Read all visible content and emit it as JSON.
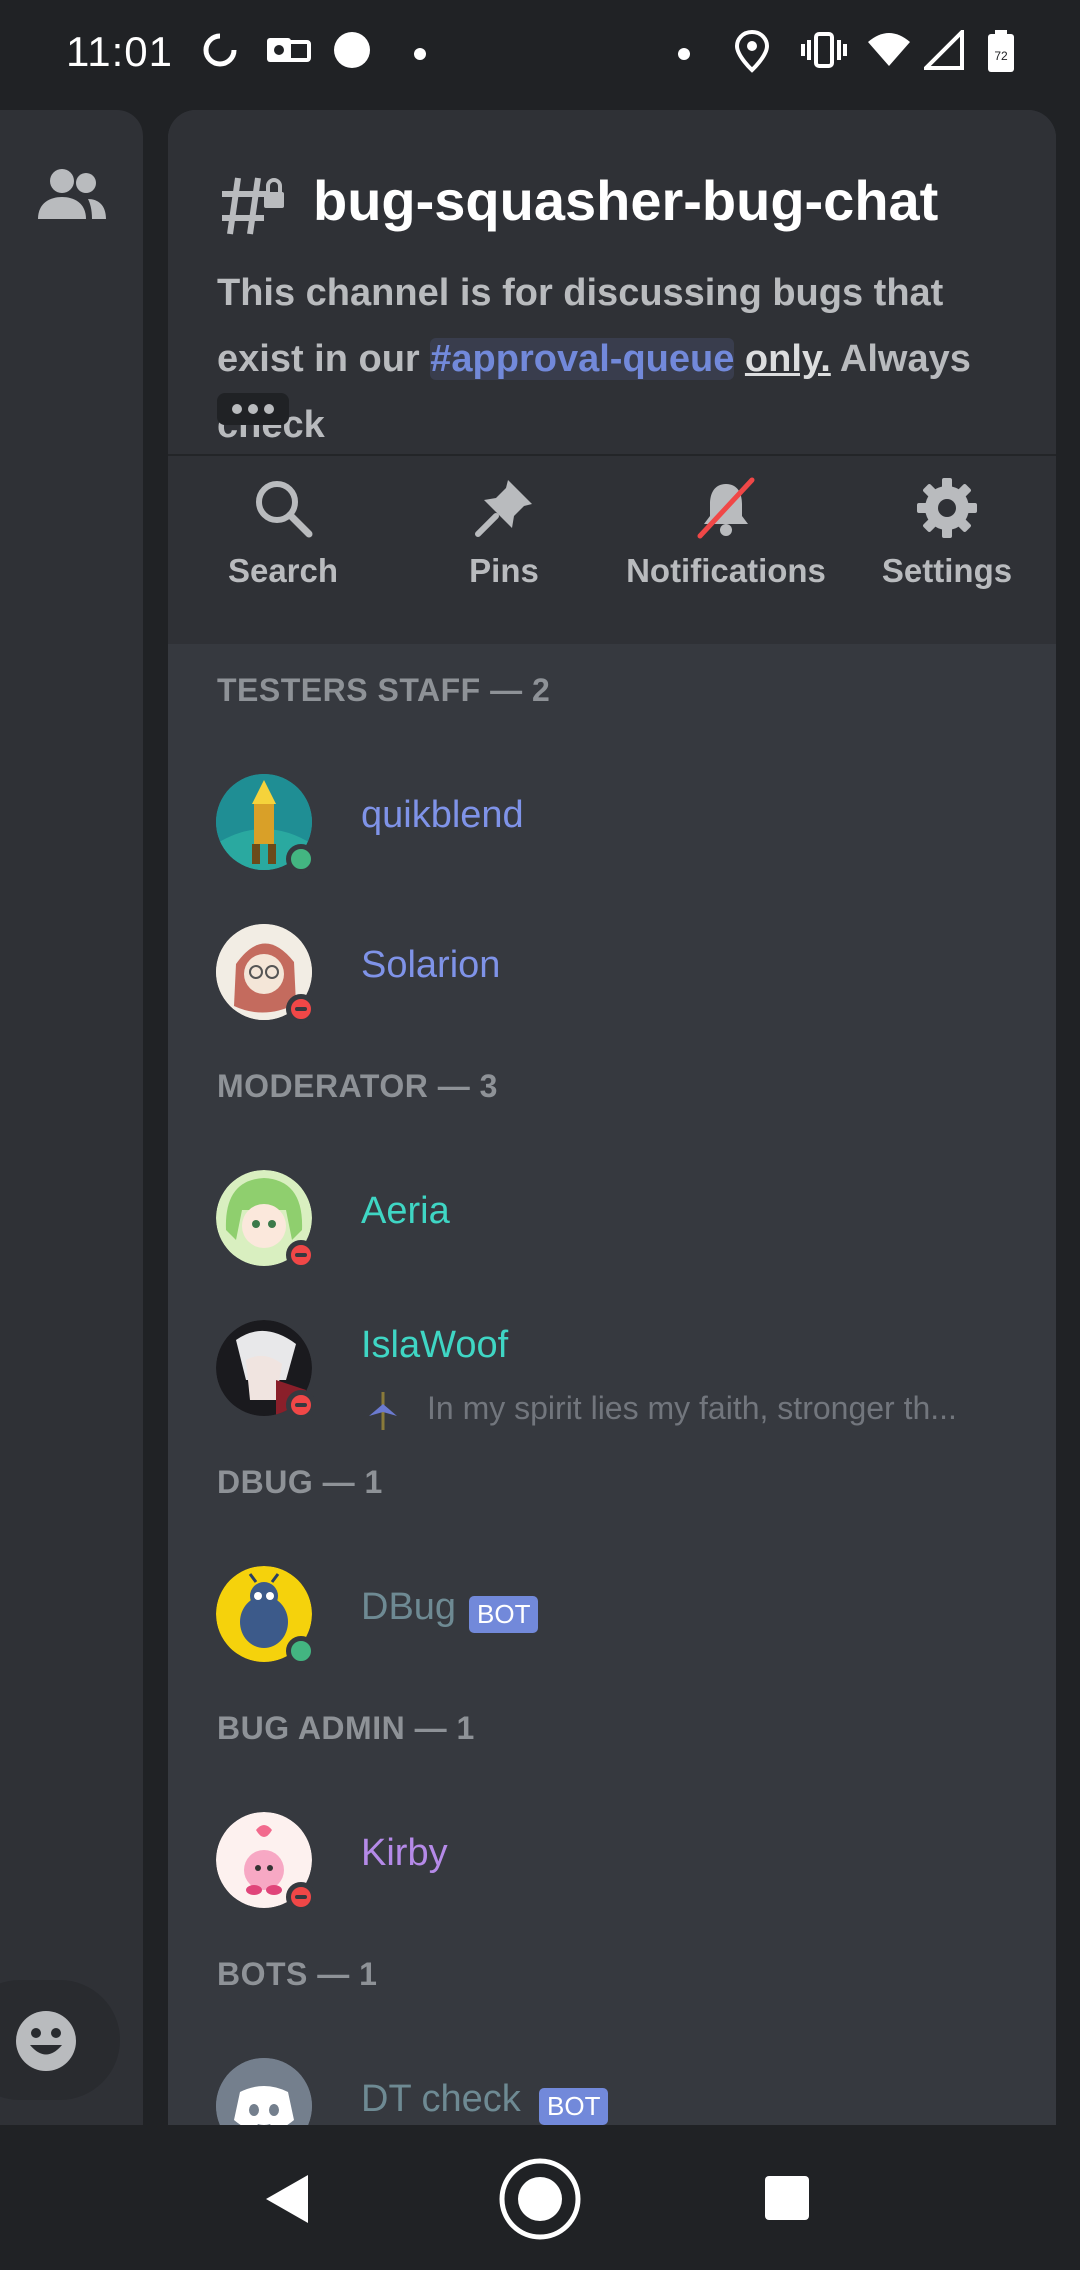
{
  "status_bar": {
    "time": "11:01",
    "battery": "72"
  },
  "channel": {
    "name": "bug-squasher-bug-chat",
    "topic_prefix": "This channel is for discussing bugs that exist in our ",
    "topic_mention": "#approval-queue",
    "topic_only": "only.",
    "topic_suffix": " Always check"
  },
  "actions": [
    {
      "label": "Search",
      "icon": "search-icon"
    },
    {
      "label": "Pins",
      "icon": "pin-icon"
    },
    {
      "label": "Notifications",
      "icon": "bell-muted-icon"
    },
    {
      "label": "Settings",
      "icon": "gear-icon"
    }
  ],
  "sections": [
    {
      "title": "TESTERS STAFF — 2"
    },
    {
      "title": "MODERATOR — 3"
    },
    {
      "title": "DBUG — 1"
    },
    {
      "title": "BUG ADMIN — 1"
    },
    {
      "title": "BOTS — 1"
    }
  ],
  "members": [
    {
      "name": "quikblend",
      "color": "#7f93e8",
      "status": "online"
    },
    {
      "name": "Solarion",
      "color": "#7f93e8",
      "status": "dnd"
    },
    {
      "name": "Aeria",
      "color": "#3fd6c4",
      "status": "dnd"
    },
    {
      "name": "IslaWoof",
      "color": "#3fd6c4",
      "status": "dnd",
      "activity": "In my spirit lies my faith, stronger th..."
    },
    {
      "name": "DBug",
      "color": "#6e8a93",
      "status": "online",
      "tag": "BOT"
    },
    {
      "name": "Kirby",
      "color": "#b58ae8",
      "status": "dnd"
    },
    {
      "name": "DT check",
      "color": "#6e8a93",
      "tag": "BOT"
    }
  ],
  "colors": {
    "background": "#36393f",
    "header": "#2f3136",
    "blurple": "#7289da",
    "online": "#43b581",
    "dnd": "#f04747"
  }
}
